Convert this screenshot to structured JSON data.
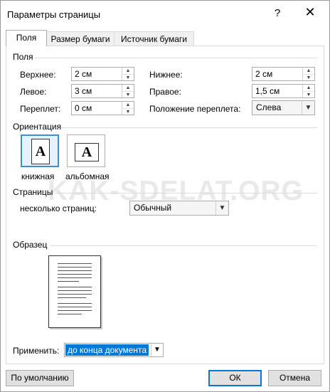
{
  "window": {
    "title": "Параметры страницы",
    "help_glyph": "?",
    "close_glyph": "✕"
  },
  "tabs": [
    {
      "label": "Поля",
      "active": true
    },
    {
      "label": "Размер бумаги",
      "active": false
    },
    {
      "label": "Источник бумаги",
      "active": false
    }
  ],
  "margins": {
    "section": "Поля",
    "top": {
      "label": "Верхнее:",
      "value": "2 см"
    },
    "bottom": {
      "label": "Нижнее:",
      "value": "2 см"
    },
    "left": {
      "label": "Левое:",
      "value": "3 см"
    },
    "right": {
      "label": "Правое:",
      "value": "1,5 см"
    },
    "gutter": {
      "label": "Переплет:",
      "value": "0 см"
    },
    "gutter_position": {
      "label": "Положение переплета:",
      "value": "Слева"
    }
  },
  "orientation": {
    "section": "Ориентация",
    "glyph": "A",
    "portrait": {
      "label": "книжная",
      "selected": true
    },
    "landscape": {
      "label": "альбомная",
      "selected": false
    }
  },
  "pages": {
    "section": "Страницы",
    "multiple_label": "несколько страниц:",
    "multiple_value": "Обычный"
  },
  "preview": {
    "section": "Образец"
  },
  "apply": {
    "label": "Применить:",
    "value": "до конца документа"
  },
  "buttons": {
    "default": "По умолчанию",
    "ok": "ОК",
    "cancel": "Отмена"
  },
  "watermark": "KAK-SDELAT.ORG",
  "colors": {
    "accent": "#0078d7",
    "selected_border": "#3c8fd6",
    "selected_bg": "#e5f1fb"
  }
}
